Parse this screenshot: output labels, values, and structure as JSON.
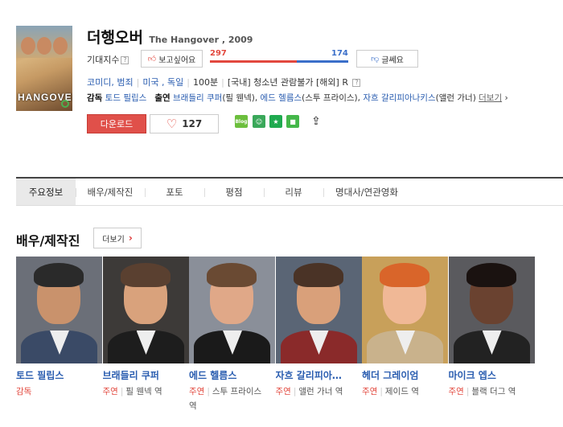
{
  "movie": {
    "title_ko": "더행오버",
    "title_en": "The Hangover , 2009",
    "poster_text": "HANGOVER"
  },
  "expectation": {
    "label": "기대지수",
    "help": "?",
    "want_label": "보고싶어요",
    "meh_label": "글쎄요",
    "want_count": "297",
    "meh_count": "174",
    "want_ratio": 0.63
  },
  "meta": {
    "genre": "코미디, 범죄",
    "country": "미국 , 독일",
    "runtime": "100분",
    "rating": "[국내] 청소년 관람불가 [해외] R",
    "rating_help": "?"
  },
  "credits": {
    "director_label": "감독",
    "director": "토드 필립스",
    "cast_label": "출연",
    "cast": [
      {
        "name": "브래들리 쿠퍼",
        "role": "(필 웬넥)"
      },
      {
        "name": "에드 헬름스",
        "role": "(스투 프라이스)"
      },
      {
        "name": "자흐 갈리피아나키스",
        "role": "(앨런 가너)"
      }
    ],
    "more": "더보기"
  },
  "actions": {
    "download": "다운로드",
    "likes": "127"
  },
  "share": {
    "blog": "Blog",
    "talk": "☺",
    "star": "★",
    "sq": "■",
    "out": "⇪"
  },
  "tabs": [
    "주요정보",
    "배우/제작진",
    "포토",
    "평점",
    "리뷰",
    "명대사/연관영화"
  ],
  "section": {
    "title": "배우/제작진",
    "more": "더보기"
  },
  "people": [
    {
      "name": "토드 필립스",
      "role": "감독",
      "character": "",
      "skin": "#c9926c",
      "hair": "#2a2a2a",
      "body": "#3a4a66",
      "bg": "#6b6f78"
    },
    {
      "name": "브래들리 쿠퍼",
      "role": "주연",
      "character": "필 웬넥 역",
      "skin": "#d9a27c",
      "hair": "#5a4030",
      "body": "#1d1d1d",
      "bg": "#3d3a38"
    },
    {
      "name": "에드 헬름스",
      "role": "주연",
      "character": "스투 프라이스 역",
      "skin": "#e0a888",
      "hair": "#6a4a33",
      "body": "#1a1a1a",
      "bg": "#8a8f99"
    },
    {
      "name": "자흐 갈리피아…",
      "role": "주연",
      "character": "앨런 가너 역",
      "skin": "#d9a07a",
      "hair": "#4a3326",
      "body": "#8a2a2a",
      "bg": "#5a6575"
    },
    {
      "name": "헤더 그레이엄",
      "role": "주연",
      "character": "제이드 역",
      "skin": "#f0b896",
      "hair": "#d9652a",
      "body": "#c9b28c",
      "bg": "#c8a05a"
    },
    {
      "name": "마이크 엡스",
      "role": "주연",
      "character": "블랙 더그 역",
      "skin": "#6a4230",
      "hair": "#1a1210",
      "body": "#222",
      "bg": "#5a5a5e"
    }
  ]
}
